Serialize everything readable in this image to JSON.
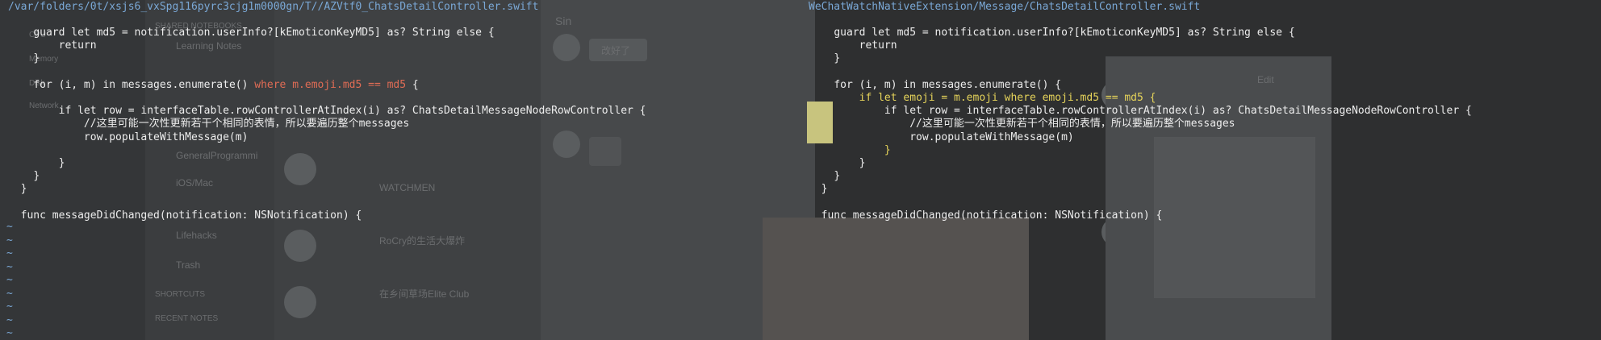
{
  "left_pane": {
    "path": "/var/folders/0t/xsjs6_vxSpg116pyrc3cjg1m0000gn/T//AZVtf0_ChatsDetailController.swift",
    "lines": [
      {
        "indent": "    ",
        "parts": [
          {
            "t": "guard let md5 = notification.userInfo?[kEmoticonKeyMD5] as? String else {"
          }
        ]
      },
      {
        "indent": "        ",
        "parts": [
          {
            "t": "return"
          }
        ]
      },
      {
        "indent": "    ",
        "parts": [
          {
            "t": "}"
          }
        ]
      },
      {
        "indent": "",
        "parts": [
          {
            "t": ""
          }
        ]
      },
      {
        "indent": "    ",
        "parts": [
          {
            "t": "for (i, m) in messages.enumerate() "
          },
          {
            "t": "where m.emoji.md5 == md5",
            "hl": "red"
          },
          {
            "t": " {"
          }
        ]
      },
      {
        "indent": "",
        "parts": [
          {
            "t": ""
          }
        ]
      },
      {
        "indent": "        ",
        "parts": [
          {
            "t": "if let row = interfaceTable.rowControllerAtIndex(i) as? ChatsDetailMessageNodeRowController {"
          }
        ]
      },
      {
        "indent": "            ",
        "parts": [
          {
            "t": "//这里可能一次性更新若干个相同的表情，所以要遍历整个messages"
          }
        ]
      },
      {
        "indent": "            ",
        "parts": [
          {
            "t": "row.populateWithMessage(m)"
          }
        ]
      },
      {
        "indent": "",
        "parts": [
          {
            "t": ""
          }
        ]
      },
      {
        "indent": "        ",
        "parts": [
          {
            "t": "}"
          }
        ]
      },
      {
        "indent": "    ",
        "parts": [
          {
            "t": "}"
          }
        ]
      },
      {
        "indent": "  ",
        "parts": [
          {
            "t": "}"
          }
        ]
      },
      {
        "indent": "",
        "parts": [
          {
            "t": ""
          }
        ]
      },
      {
        "indent": "  ",
        "parts": [
          {
            "t": "func messageDidChanged(notification: NSNotification) {"
          }
        ]
      }
    ],
    "tilde_count": 9,
    "tilde_char": "~"
  },
  "right_pane": {
    "path": "WeChatWatchNativeExtension/Message/ChatsDetailController.swift",
    "lines": [
      {
        "indent": "    ",
        "parts": [
          {
            "t": "guard let md5 = notification.userInfo?[kEmoticonKeyMD5] as? String else {"
          }
        ]
      },
      {
        "indent": "        ",
        "parts": [
          {
            "t": "return"
          }
        ]
      },
      {
        "indent": "    ",
        "parts": [
          {
            "t": "}"
          }
        ]
      },
      {
        "indent": "",
        "parts": [
          {
            "t": ""
          }
        ]
      },
      {
        "indent": "    ",
        "parts": [
          {
            "t": "for (i, m) in messages.enumerate() {"
          }
        ]
      },
      {
        "indent": "        ",
        "parts": [
          {
            "t": "if let emoji = m.emoji where emoji.md5 == md5 {",
            "hl": "yellow"
          }
        ]
      },
      {
        "indent": "            ",
        "parts": [
          {
            "t": "if let row = interfaceTable.rowControllerAtIndex(i) as? ChatsDetailMessageNodeRowController {"
          }
        ]
      },
      {
        "indent": "                ",
        "parts": [
          {
            "t": "//这里可能一次性更新若干个相同的表情，所以要遍历整个messages"
          }
        ]
      },
      {
        "indent": "                ",
        "parts": [
          {
            "t": "row.populateWithMessage(m)"
          }
        ]
      },
      {
        "indent": "            ",
        "parts": [
          {
            "t": "}",
            "hl": "yellow"
          }
        ]
      },
      {
        "indent": "        ",
        "parts": [
          {
            "t": "}"
          }
        ]
      },
      {
        "indent": "    ",
        "parts": [
          {
            "t": "}"
          }
        ]
      },
      {
        "indent": "  ",
        "parts": [
          {
            "t": "}"
          }
        ]
      },
      {
        "indent": "",
        "parts": [
          {
            "t": ""
          }
        ]
      },
      {
        "indent": "  ",
        "parts": [
          {
            "t": "func messageDidChanged(notification: NSNotification) {"
          }
        ]
      }
    ]
  },
  "background": {
    "chat_title": "Sin",
    "chat_bubble": "改好了",
    "notes_sidebar": [
      "SHARED NOTEBOOKS",
      "Learning Notes",
      "GeneralProgrammi",
      "iOS/Mac",
      "Lifehacks",
      "Trash",
      "SHORTCUTS",
      "RECENT NOTES"
    ],
    "system_items": [
      "CPU",
      "Memory",
      "Disk",
      "Network"
    ],
    "notes_list": [
      "WATCHMEN",
      "RoCry的生活大爆炸",
      "在乡间草场Elite Club"
    ],
    "right_window_label": "Edit"
  }
}
